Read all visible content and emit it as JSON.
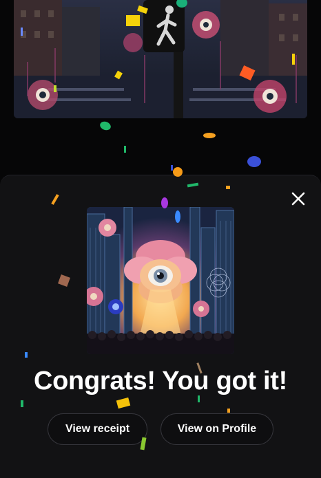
{
  "modal": {
    "headline": "Congrats! You got it!",
    "buttons": {
      "view_receipt": "View receipt",
      "view_on_profile": "View on Profile"
    }
  },
  "icons": {
    "close": "close-icon"
  },
  "colors": {
    "page_background": "#060607",
    "sheet_background": "#121214",
    "button_border": "#36363c",
    "text": "#ffffff"
  }
}
